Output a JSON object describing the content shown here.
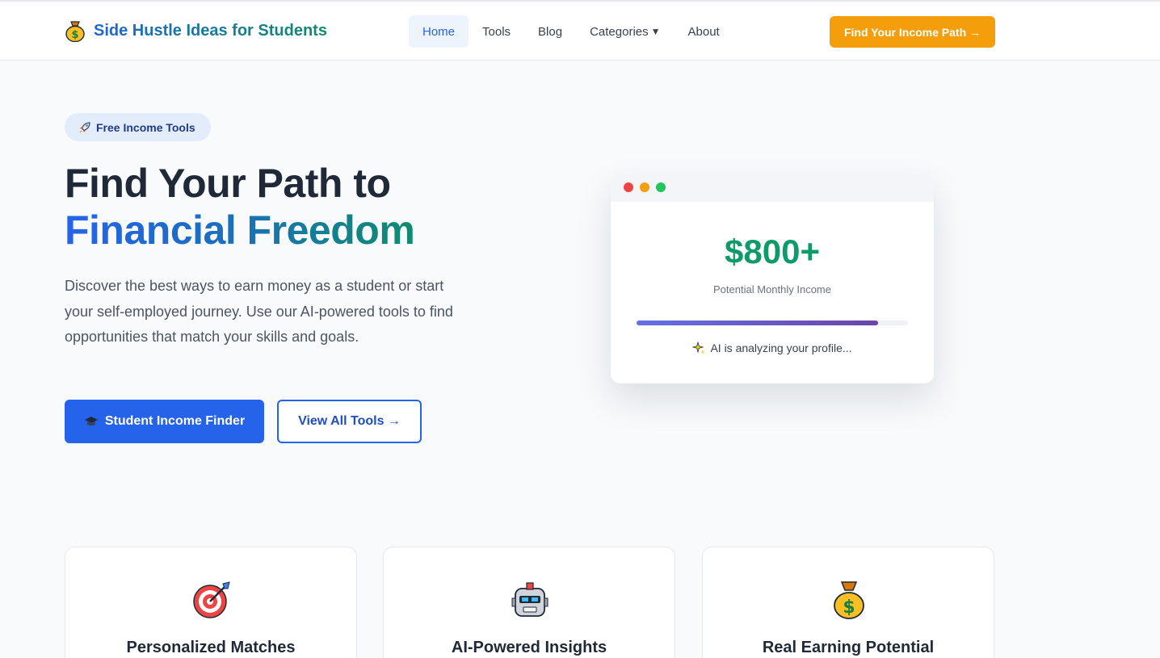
{
  "header": {
    "site_title": "Side Hustle Ideas for Students",
    "logo_icon": "money-bag-icon",
    "nav": [
      {
        "label": "Home",
        "active": true
      },
      {
        "label": "Tools",
        "active": false
      },
      {
        "label": "Blog",
        "active": false
      },
      {
        "label": "Categories",
        "active": false,
        "has_dropdown": true
      },
      {
        "label": "About",
        "active": false
      }
    ],
    "categories_caret": "▼",
    "cta_label": "Find Your Income Path →"
  },
  "hero": {
    "badge_icon": "rocket-icon",
    "badge_label": "Free Income Tools",
    "heading_line1": "Find Your Path to",
    "heading_line2": "Financial Freedom",
    "lead": "Discover the best ways to earn money as a student or start your self-employed journey. Use our AI-powered tools to find opportunities that match your skills and goals.",
    "primary_button": {
      "icon": "graduation-cap-icon",
      "label": "Student Income Finder"
    },
    "secondary_button": {
      "label": "View All Tools →"
    }
  },
  "mock_card": {
    "amount": "$800+",
    "amount_label": "Potential Monthly Income",
    "progress": 0.89,
    "status_icon": "sparkles-icon",
    "status_text": "AI is analyzing your profile..."
  },
  "features": [
    {
      "icon": "target-icon",
      "title": "Personalized Matches"
    },
    {
      "icon": "robot-icon",
      "title": "AI-Powered Insights"
    },
    {
      "icon": "money-bag-icon",
      "title": "Real Earning Potential"
    }
  ],
  "colors": {
    "primary": "#2563eb",
    "accent": "#f59e0b",
    "success": "#0f9a6a",
    "background": "#f8fafc"
  }
}
